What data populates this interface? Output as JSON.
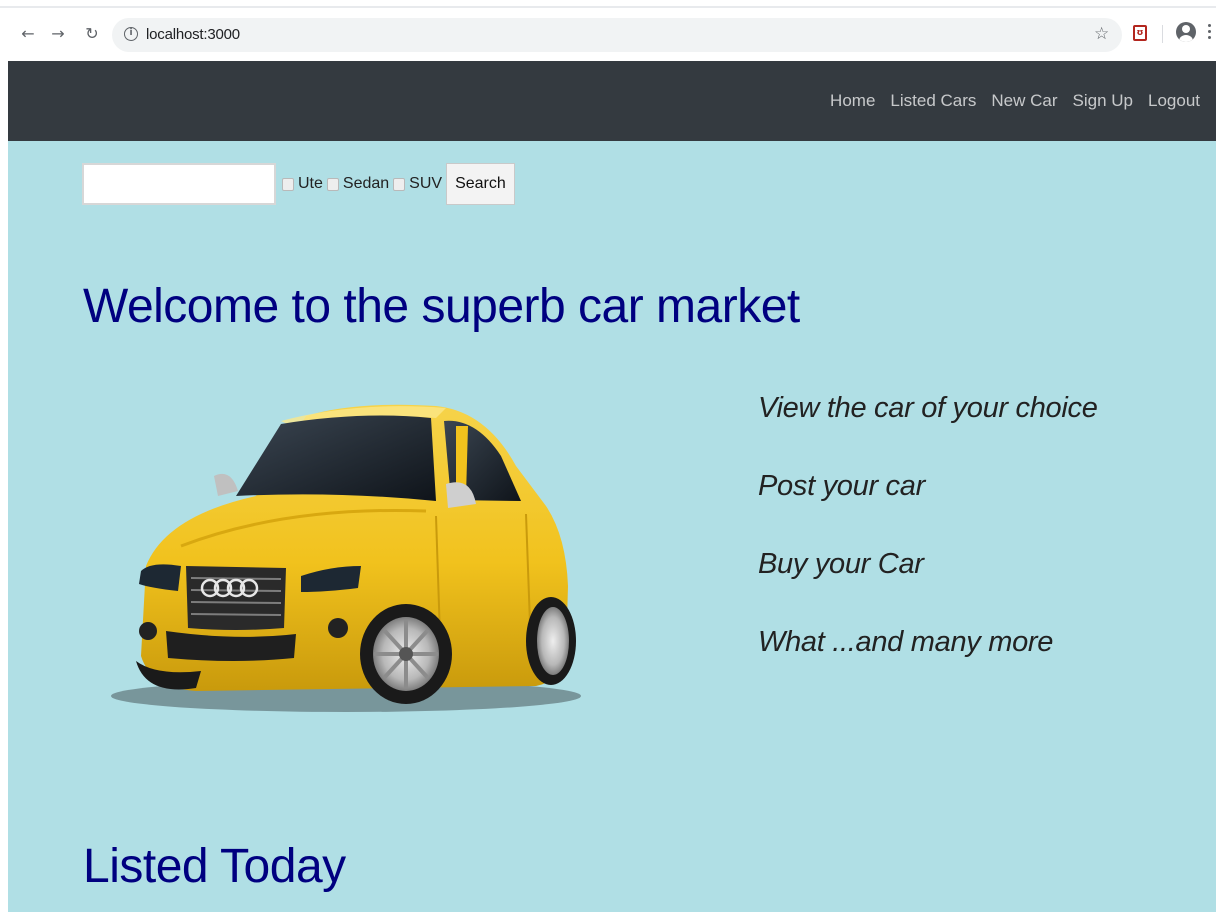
{
  "browser": {
    "url": "localhost:3000",
    "icons": {
      "back": "back-arrow-icon",
      "forward": "forward-arrow-icon",
      "reload": "reload-icon",
      "info": "info-icon",
      "bookmark": "star-icon",
      "extension": "shield-extension-icon",
      "profile": "profile-icon",
      "menu": "kebab-menu-icon"
    }
  },
  "navbar": {
    "links": [
      "Home",
      "Listed Cars",
      "New Car",
      "Sign Up",
      "Logout"
    ]
  },
  "search": {
    "input_value": "",
    "checkboxes": [
      {
        "label": "Ute",
        "checked": false
      },
      {
        "label": "Sedan",
        "checked": false
      },
      {
        "label": "SUV",
        "checked": false
      }
    ],
    "button_label": "Search"
  },
  "hero": {
    "heading": "Welcome to the superb car market",
    "image": "yellow-audi-car-image",
    "features": [
      "View the car of your choice",
      "Post your car",
      "Buy your Car",
      "What ...and many more"
    ]
  },
  "listed": {
    "heading": "Listed Today"
  },
  "colors": {
    "page_background": "#b0dfe5",
    "navbar_background": "#343a40",
    "heading_color": "#000080"
  }
}
